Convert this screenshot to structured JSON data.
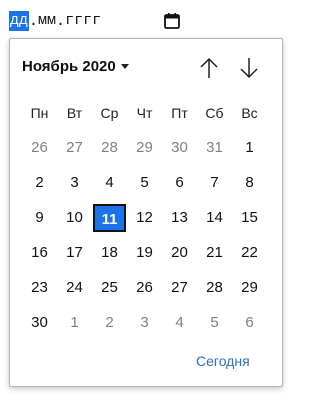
{
  "input": {
    "day_placeholder": "дд",
    "month_placeholder": "мм",
    "year_placeholder": "гггг",
    "separator": "."
  },
  "calendar": {
    "month_label": "Ноябрь 2020",
    "weekdays": [
      "Пн",
      "Вт",
      "Ср",
      "Чт",
      "Пт",
      "Сб",
      "Вс"
    ],
    "weeks": [
      [
        {
          "d": "26",
          "other": true
        },
        {
          "d": "27",
          "other": true
        },
        {
          "d": "28",
          "other": true
        },
        {
          "d": "29",
          "other": true
        },
        {
          "d": "30",
          "other": true
        },
        {
          "d": "31",
          "other": true
        },
        {
          "d": "1"
        }
      ],
      [
        {
          "d": "2"
        },
        {
          "d": "3"
        },
        {
          "d": "4"
        },
        {
          "d": "5"
        },
        {
          "d": "6"
        },
        {
          "d": "7"
        },
        {
          "d": "8"
        }
      ],
      [
        {
          "d": "9"
        },
        {
          "d": "10"
        },
        {
          "d": "11",
          "selected": true
        },
        {
          "d": "12"
        },
        {
          "d": "13"
        },
        {
          "d": "14"
        },
        {
          "d": "15"
        }
      ],
      [
        {
          "d": "16"
        },
        {
          "d": "17"
        },
        {
          "d": "18"
        },
        {
          "d": "19"
        },
        {
          "d": "20"
        },
        {
          "d": "21"
        },
        {
          "d": "22"
        }
      ],
      [
        {
          "d": "23"
        },
        {
          "d": "24"
        },
        {
          "d": "25"
        },
        {
          "d": "26"
        },
        {
          "d": "27"
        },
        {
          "d": "28"
        },
        {
          "d": "29"
        }
      ],
      [
        {
          "d": "30"
        },
        {
          "d": "1",
          "other": true
        },
        {
          "d": "2",
          "other": true
        },
        {
          "d": "3",
          "other": true
        },
        {
          "d": "4",
          "other": true
        },
        {
          "d": "5",
          "other": true
        },
        {
          "d": "6",
          "other": true
        }
      ]
    ],
    "today_label": "Сегодня"
  },
  "colors": {
    "accent": "#1a73e8",
    "link": "#2f6fb8",
    "muted": "#808080"
  },
  "icons": {
    "calendar": "calendar-icon",
    "prev": "arrow-up-icon",
    "next": "arrow-down-icon",
    "month_menu": "caret-down-icon"
  }
}
